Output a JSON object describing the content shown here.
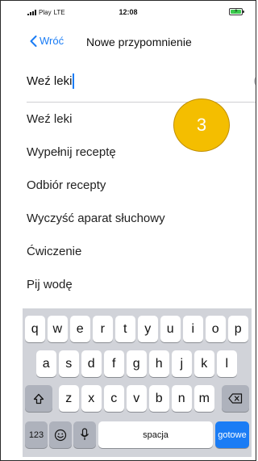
{
  "status_bar": {
    "carrier": "Play",
    "network": "LTE",
    "time": "12:08"
  },
  "nav": {
    "back_label": "Wróć",
    "title": "Nowe przypomnienie"
  },
  "search": {
    "value": "Weź leki"
  },
  "suggestions": [
    "Weź leki",
    "Wypełnij receptę",
    "Odbiór recepty",
    "Wyczyść aparat słuchowy",
    "Ćwiczenie",
    "Pij wodę"
  ],
  "step_badge": "3",
  "keyboard": {
    "row1": [
      "q",
      "w",
      "e",
      "r",
      "t",
      "y",
      "u",
      "i",
      "o",
      "p"
    ],
    "row2": [
      "a",
      "s",
      "d",
      "f",
      "g",
      "h",
      "j",
      "k",
      "l"
    ],
    "row3": [
      "z",
      "x",
      "c",
      "v",
      "b",
      "n",
      "m"
    ],
    "numbers_label": "123",
    "space_label": "spacja",
    "done_label": "gotowe"
  },
  "colors": {
    "accent": "#1a7cf5",
    "badge": "#f4be00",
    "keyboard_bg": "#d1d3d9"
  }
}
